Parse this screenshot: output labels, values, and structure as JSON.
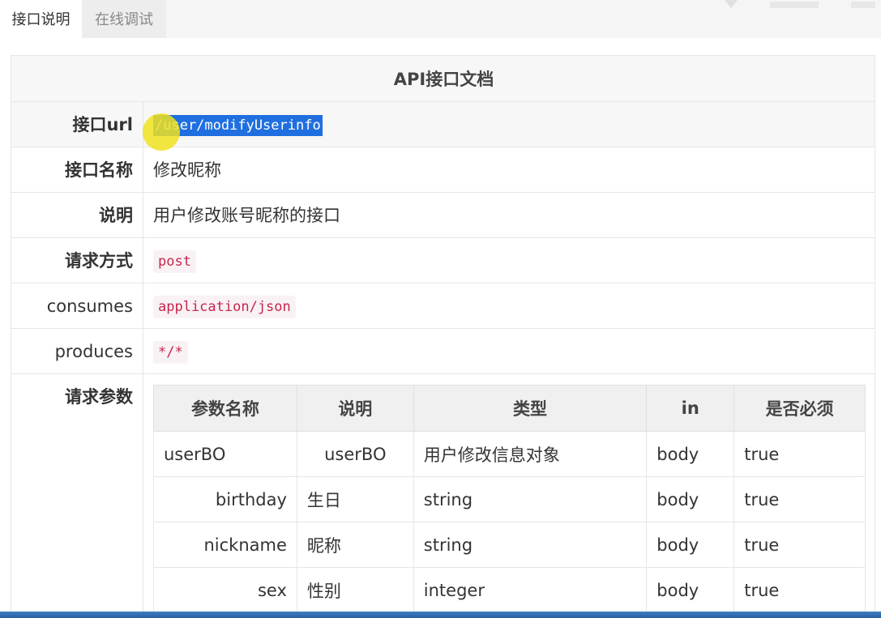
{
  "tabs": [
    "接口说明",
    "在线调试"
  ],
  "doc": {
    "title": "API接口文档",
    "rows": [
      {
        "label": "接口url",
        "value": "/user/modifyUserinfo",
        "kind": "selected-code"
      },
      {
        "label": "接口名称",
        "value": "修改昵称",
        "kind": "text"
      },
      {
        "label": "说明",
        "value": "用户修改账号昵称的接口",
        "kind": "text"
      },
      {
        "label": "请求方式",
        "value": "post",
        "kind": "code"
      },
      {
        "label": "consumes",
        "value": "application/json",
        "kind": "code"
      },
      {
        "label": "produces",
        "value": "*/*",
        "kind": "code"
      }
    ],
    "params_label": "请求参数",
    "params_headers": [
      "参数名称",
      "说明",
      "类型",
      "in",
      "是否必须"
    ],
    "params_rows": [
      {
        "name": "userBO",
        "desc": "userBO",
        "type": "用户修改信息对象",
        "in": "body",
        "required": "true"
      },
      {
        "name": "birthday",
        "desc": "生日",
        "type": "string",
        "in": "body",
        "required": "true"
      },
      {
        "name": "nickname",
        "desc": "昵称",
        "type": "string",
        "in": "body",
        "required": "true"
      },
      {
        "name": "sex",
        "desc": "性别",
        "type": "integer",
        "in": "body",
        "required": "true"
      }
    ]
  },
  "colors": {
    "selection": "#1f6fe0",
    "code_text": "#c7254e",
    "code_bg": "#f9f2f4",
    "cursor_highlight": "#f0e21e"
  }
}
